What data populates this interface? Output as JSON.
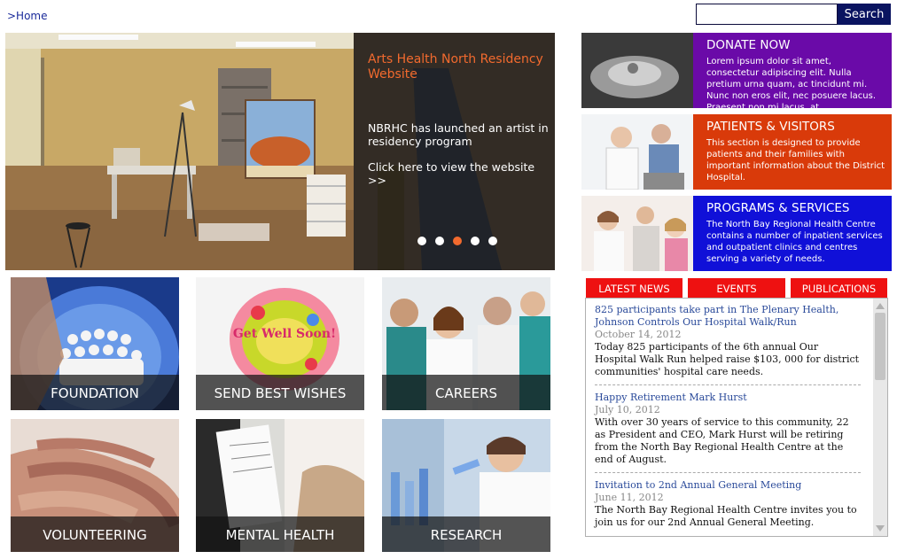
{
  "breadcrumb": {
    "home": ">Home"
  },
  "search": {
    "placeholder": "",
    "button_label": "Search"
  },
  "hero": {
    "title": "Arts Health North Residency Website",
    "text": "NBRHC has launched an artist in residency program",
    "link": "Click here to view the website >>",
    "slides": 5,
    "active_slide": 3
  },
  "tiles": [
    {
      "label": "FOUNDATION"
    },
    {
      "label": "SEND BEST WISHES"
    },
    {
      "label": "CAREERS"
    },
    {
      "label": "VOLUNTEERING"
    },
    {
      "label": "MENTAL HEALTH"
    },
    {
      "label": "RESEARCH"
    }
  ],
  "balloon_text": "Get Well Soon!",
  "promos": [
    {
      "title": "DONATE NOW",
      "text": "Lorem ipsum dolor sit amet, consectetur adipiscing elit. Nulla pretium urna quam, ac tincidunt mi. Nunc non eros elit, nec posuere lacus. Praesent non mi lacus, at",
      "color": "#6a0aa8"
    },
    {
      "title": "PATIENTS & VISITORS",
      "text": "This section is designed to provide patients and their families with important information about the District Hospital.",
      "color": "#d93a0a"
    },
    {
      "title": "PROGRAMS & SERVICES",
      "text": "The North Bay Regional Health Centre contains a number of inpatient services and outpatient clinics and centres serving a variety of needs.",
      "color": "#1010d8"
    }
  ],
  "news_tabs": [
    "LATEST NEWS",
    "EVENTS",
    "PUBLICATIONS"
  ],
  "news": [
    {
      "title": "825 participants take part in The Plenary Health, Johnson Controls Our Hospital Walk/Run",
      "date": "October 14, 2012",
      "text": "Today 825 participants of the 6th annual Our Hospital Walk Run helped raise $103, 000 for district communities' hospital care needs."
    },
    {
      "title": "Happy Retirement Mark Hurst",
      "date": "July 10, 2012",
      "text": "With over 30 years of service to this community, 22 as President and CEO, Mark Hurst will be retiring from the North Bay Regional Health Centre at the end of August."
    },
    {
      "title": "Invitation to 2nd Annual General Meeting",
      "date": "June 11, 2012",
      "text": "The North Bay Regional Health Centre invites you to join us for our 2nd Annual General Meeting."
    }
  ]
}
